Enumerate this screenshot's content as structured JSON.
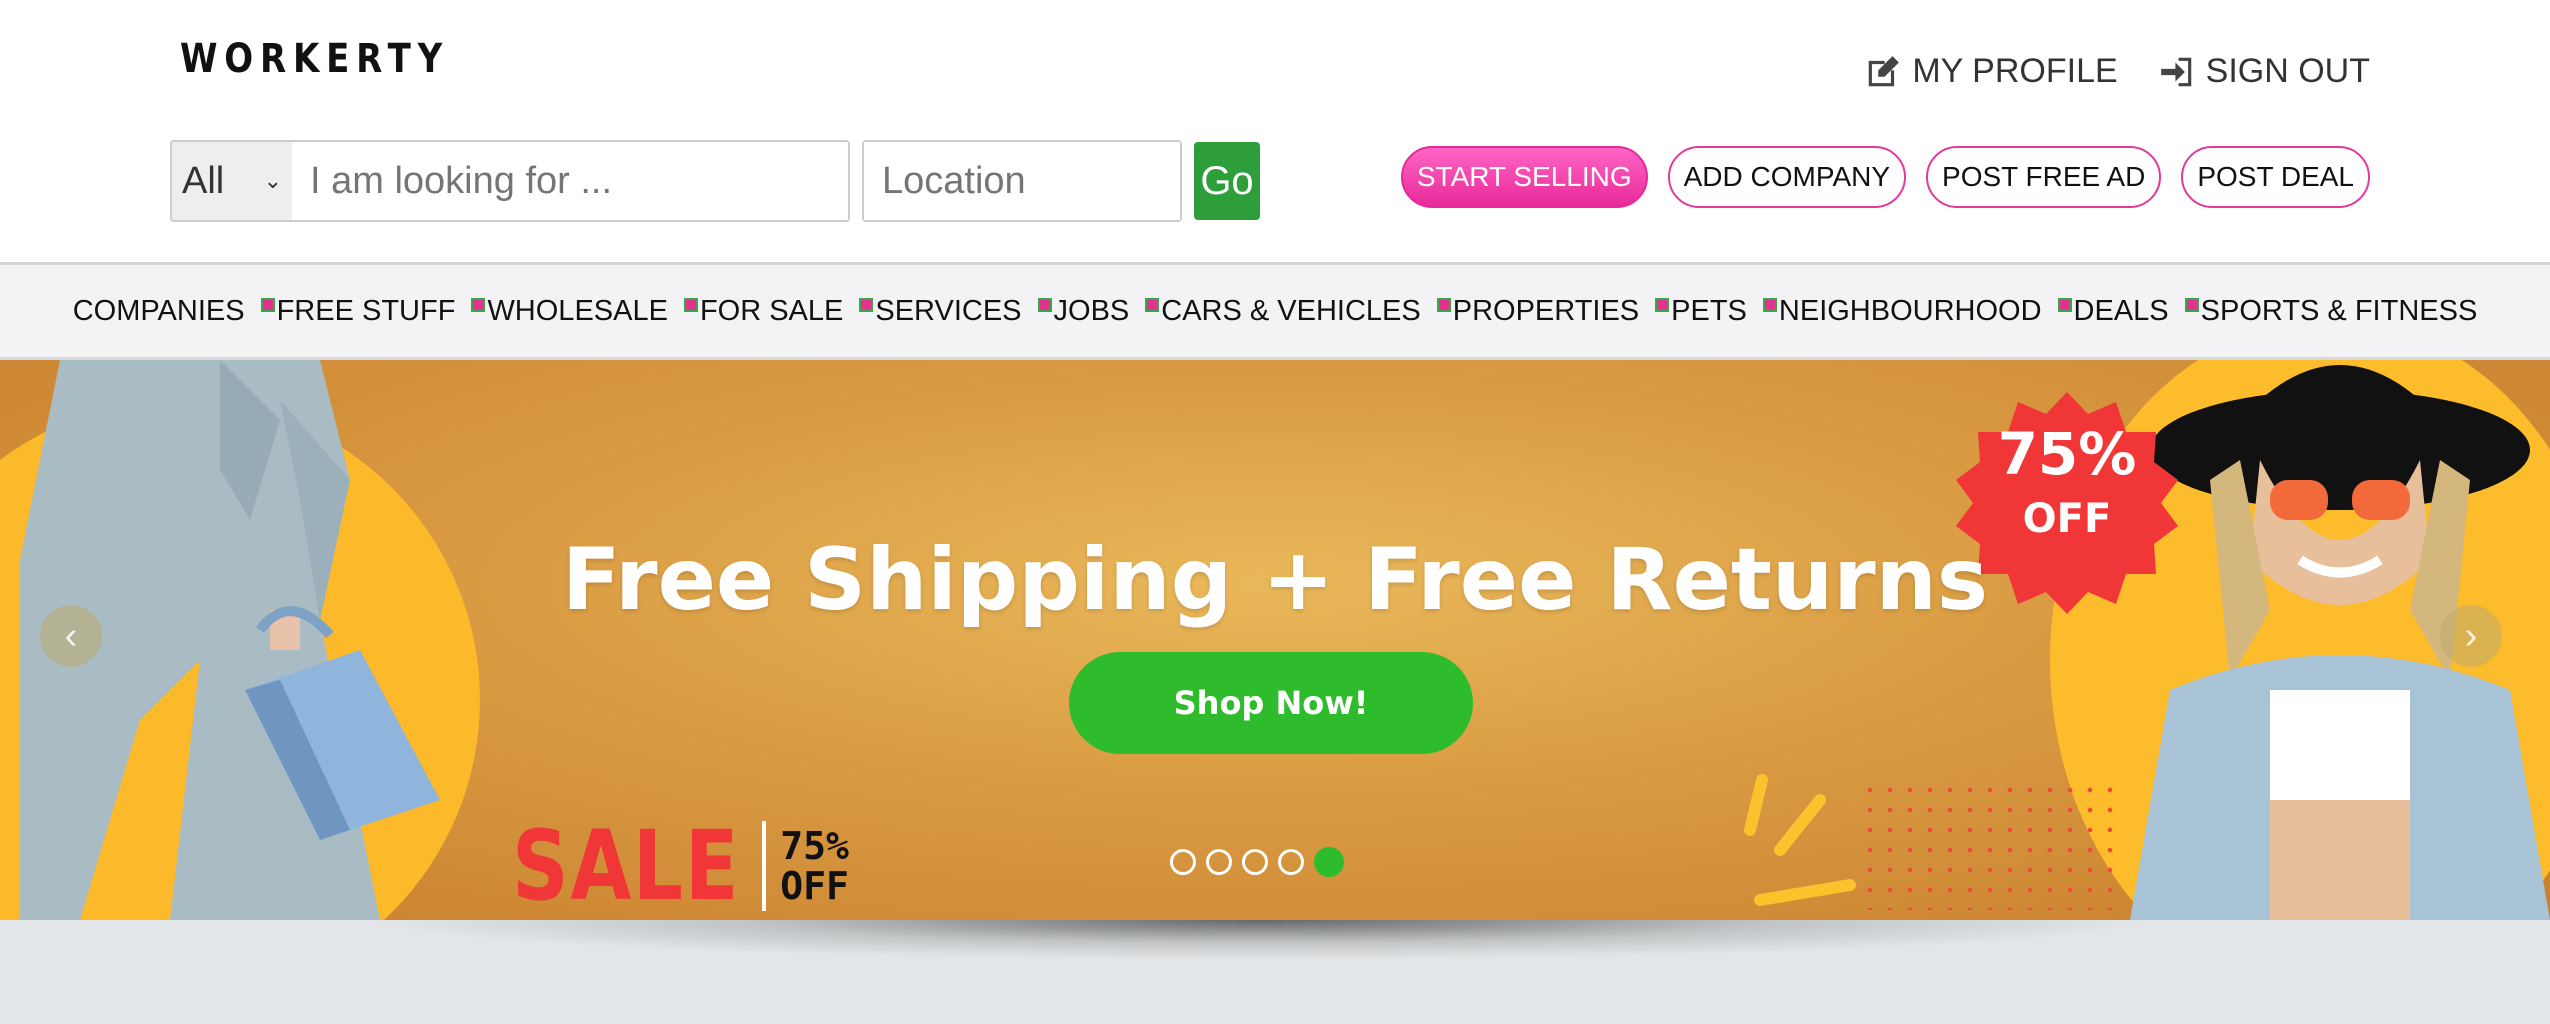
{
  "header": {
    "logo": "WORKERTY",
    "user_links": [
      {
        "label": "MY PROFILE",
        "icon": "edit-profile-icon"
      },
      {
        "label": "SIGN OUT",
        "icon": "sign-out-icon"
      }
    ],
    "search": {
      "category_value": "All",
      "query_placeholder": "I am looking for ...",
      "location_placeholder": "Location",
      "go_label": "Go"
    },
    "actions": {
      "start_selling": "START SELLING",
      "add_company": "ADD COMPANY",
      "post_free_ad": "POST FREE AD",
      "post_deal": "POST DEAL"
    }
  },
  "nav": {
    "items": [
      "COMPANIES",
      "FREE STUFF",
      "WHOLESALE",
      "FOR SALE",
      "SERVICES",
      "JOBS",
      "CARS & VEHICLES",
      "PROPERTIES",
      "PETS",
      "NEIGHBOURHOOD",
      "DEALS",
      "SPORTS & FITNESS"
    ]
  },
  "banner": {
    "headline": "Free Shipping + Free Returns",
    "cta": "Shop Now!",
    "sale_word": "SALE",
    "sale_pct_line1": "75%",
    "sale_pct_line2": "OFF",
    "badge_pct": "75%",
    "badge_off": "OFF",
    "slide_count": 5,
    "active_slide": 5,
    "colors": {
      "accent_green": "#2ebb2c",
      "sale_red": "#f03636",
      "pink": "#e8299a"
    }
  }
}
